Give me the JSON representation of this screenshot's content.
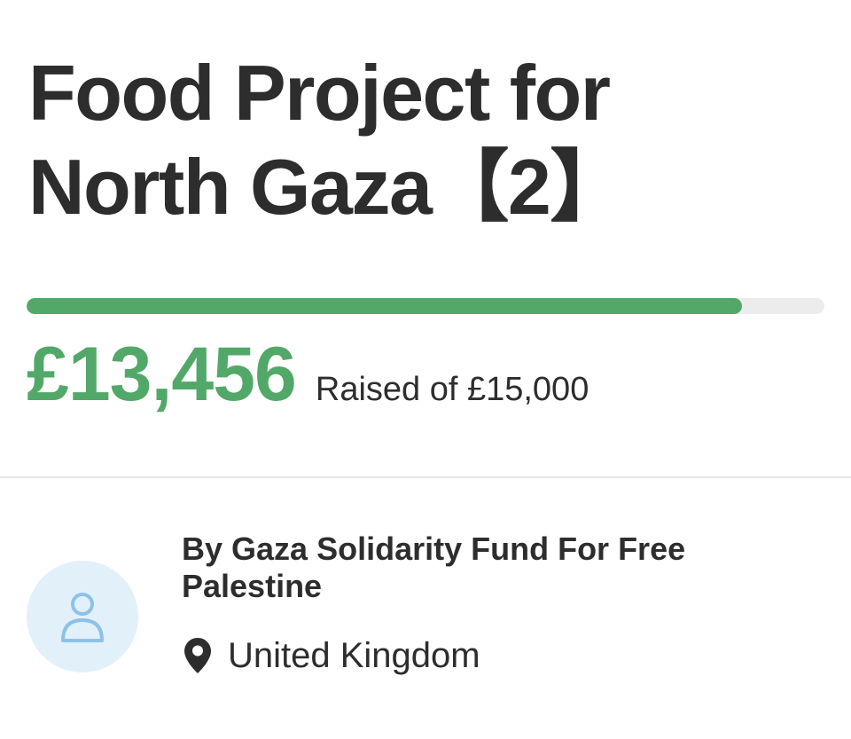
{
  "campaign": {
    "title": "Food Project for North Gaza【2】"
  },
  "fundraising": {
    "raised_amount": "£13,456",
    "goal_text": "Raised of £15,000",
    "progress_fraction": 0.897,
    "accent_color": "#52a868"
  },
  "organizer": {
    "name": "By Gaza Solidarity Fund For Free Palestine",
    "location": "United Kingdom",
    "avatar_icon": "user-icon",
    "location_icon": "map-pin-icon"
  }
}
